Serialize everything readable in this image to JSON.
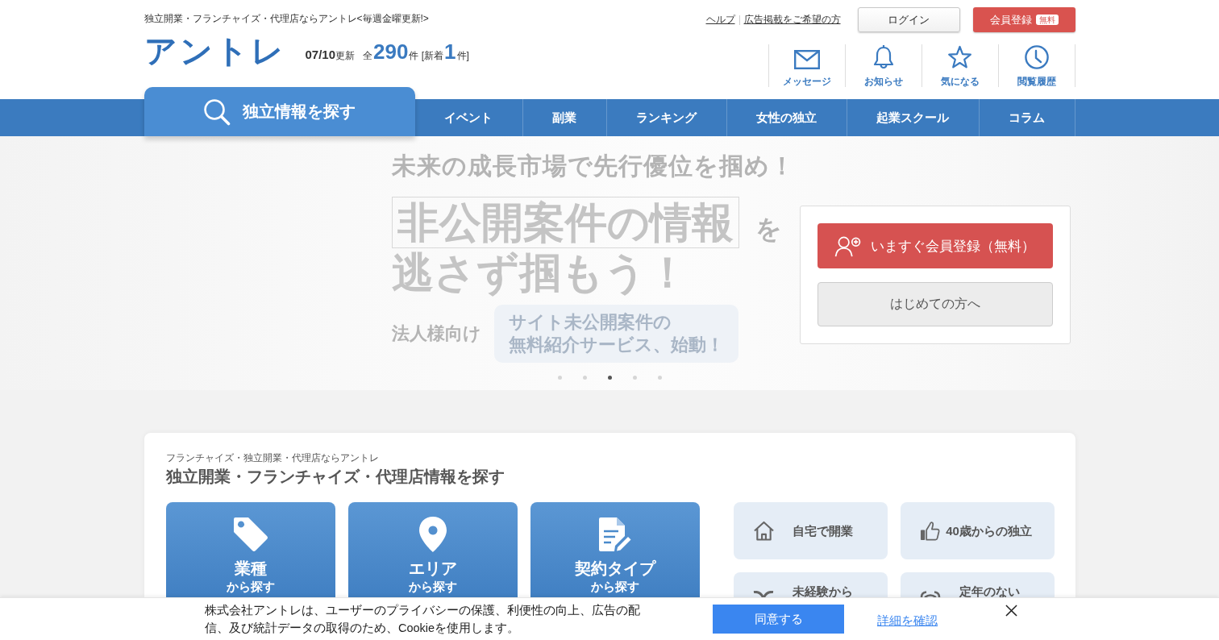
{
  "header": {
    "tagline": "独立開業・フランチャイズ・代理店ならアントレ<毎週金曜更新!>",
    "links": [
      "ヘルプ",
      "広告掲載をご希望の方"
    ],
    "login_button": "ログイン",
    "register_button": {
      "label": "会員登録",
      "badge": "無料"
    },
    "logo": "アントレ",
    "stats": [
      {
        "kind": "date",
        "text": "**07/10**更新"
      },
      {
        "kind": "label",
        "text": "全"
      },
      {
        "kind": "number",
        "text": "290"
      },
      {
        "kind": "label",
        "text": "件 [新着"
      },
      {
        "kind": "number",
        "text": "1"
      },
      {
        "kind": "label",
        "text": "件]"
      }
    ],
    "icon_links": [
      {
        "kind": "mail",
        "label": "メッセージ"
      },
      {
        "kind": "bell",
        "label": "お知らせ"
      },
      {
        "kind": "star",
        "label": "気になる"
      },
      {
        "kind": "clock",
        "label": "閲覧履歴"
      }
    ]
  },
  "nav": {
    "search_tab": "独立情報を探す",
    "items": [
      "イベント",
      "副業",
      "ランキング",
      "女性の独立",
      "起業スクール",
      "コラム"
    ]
  },
  "hero": {
    "headline": "未来の成長市場で先行優位を掴め！",
    "highlight": "非公開案件の情報",
    "highlight_suffix": "を",
    "tagline": "逃さず掴もう！",
    "audience_label": "法人様向け",
    "service_lines": [
      "サイト未公開案件の",
      "無料紹介サービス、始動！"
    ],
    "dots": [
      {
        "selected": false
      },
      {
        "selected": false
      },
      {
        "selected": true
      },
      {
        "selected": false
      },
      {
        "selected": false
      }
    ]
  },
  "register_panel": {
    "primary_button": "いますぐ会員登録（無料）",
    "secondary_button": "はじめての方へ"
  },
  "search_section": {
    "subtitle": "フランチャイズ・独立開業・代理店ならアントレ",
    "title": "独立開業・フランチャイズ・代理店情報を探す",
    "category_cards": [
      {
        "kind": "tag",
        "title": "業種",
        "subtitle": "から探す"
      },
      {
        "kind": "pin",
        "title": "エリア",
        "subtitle": "から探す"
      },
      {
        "kind": "document",
        "title": "契約タイプ",
        "subtitle": "から探す"
      }
    ],
    "feature_tiles": [
      {
        "kind": "home",
        "label": "自宅で開業"
      },
      {
        "kind": "thumbs_up",
        "label": "40歳からの独立"
      },
      {
        "kind": "sprout",
        "label": "未経験から"
      },
      {
        "kind": "alarm",
        "label": "定年のない"
      }
    ]
  },
  "cookie_banner": {
    "text": "株式会社アントレは、ユーザーのプライバシーの保護、利便性の向上、広告の配信、及び統計データの取得のため、Cookieを使用します。",
    "accept_button": "同意する",
    "details_link": "詳細を確認"
  }
}
